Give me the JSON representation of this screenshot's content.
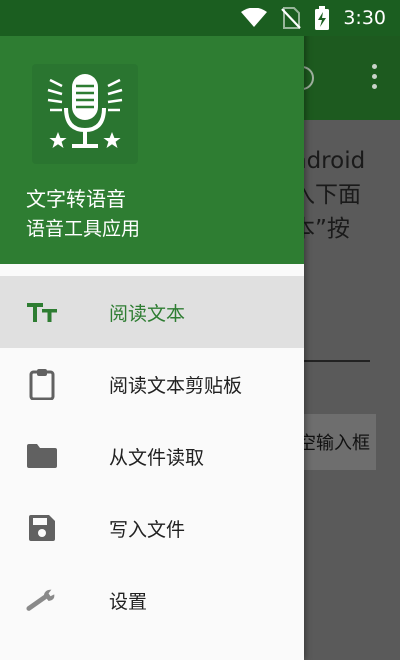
{
  "status_bar": {
    "time": "3:30"
  },
  "drawer": {
    "title": "文字转语音",
    "subtitle": "语音工具应用",
    "items": [
      {
        "label": "阅读文本",
        "icon": "text-size-icon",
        "active": true
      },
      {
        "label": "阅读文本剪贴板",
        "icon": "clipboard-icon",
        "active": false
      },
      {
        "label": "从文件读取",
        "icon": "folder-icon",
        "active": false
      },
      {
        "label": "写入文件",
        "icon": "save-icon",
        "active": false
      },
      {
        "label": "设置",
        "icon": "wrench-icon",
        "active": false
      }
    ]
  },
  "background_app": {
    "text_lines": [
      "ndroid",
      "入下面",
      "本”按"
    ],
    "button_label": "空输入框"
  },
  "colors": {
    "header_green": "#2e7d32",
    "status_bar_green": "#1b5e20",
    "active_row": "#e0e0e0",
    "scrim": "#5a5a5a"
  }
}
